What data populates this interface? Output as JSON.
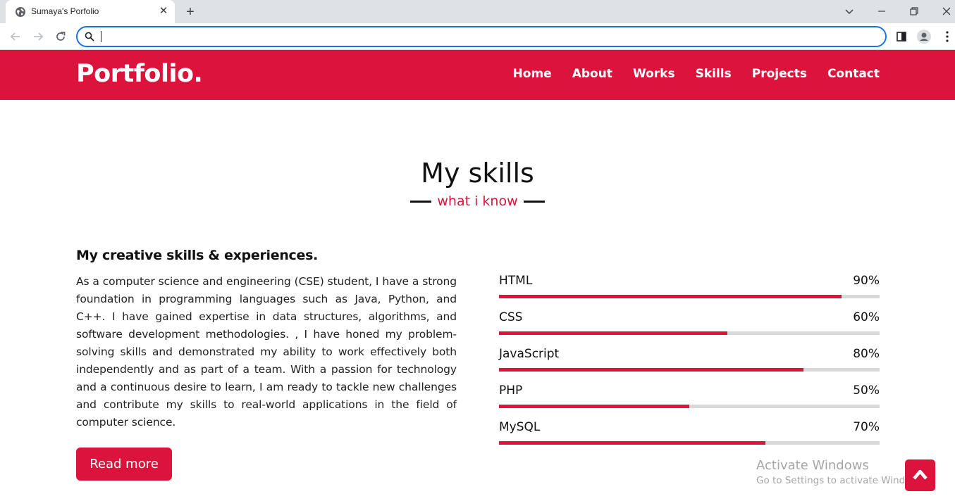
{
  "browser": {
    "tab_title": "Sumaya's Porfolio",
    "address_value": ""
  },
  "site": {
    "logo": "Portfolio.",
    "nav": [
      "Home",
      "About",
      "Works",
      "Skills",
      "Projects",
      "Contact"
    ]
  },
  "skills_section": {
    "title": "My skills",
    "subtitle": "what i know",
    "heading": "My creative skills & experiences.",
    "paragraph": "As a computer science and engineering (CSE) student, I have a strong foundation in programming languages such as Java, Python, and C++. I have gained expertise in data structures, algorithms, and software development methodologies. , I have honed my problem-solving skills and demonstrated my ability to work effectively both independently and as part of a team. With a passion for technology and a continuous desire to learn, I am ready to tackle new challenges and contribute my skills to real-world applications in the field of computer science.",
    "button_label": "Read more",
    "skills": [
      {
        "name": "HTML",
        "percent_label": "90%",
        "level": 0.9
      },
      {
        "name": "CSS",
        "percent_label": "60%",
        "level": 0.6
      },
      {
        "name": "JavaScript",
        "percent_label": "80%",
        "level": 0.8
      },
      {
        "name": "PHP",
        "percent_label": "50%",
        "level": 0.5
      },
      {
        "name": "MySQL",
        "percent_label": "70%",
        "level": 0.7
      }
    ]
  },
  "watermark": {
    "title": "Activate Windows",
    "subtitle": "Go to Settings to activate Windows."
  },
  "colors": {
    "accent": "#dc143c",
    "track": "#d9d9d9"
  }
}
